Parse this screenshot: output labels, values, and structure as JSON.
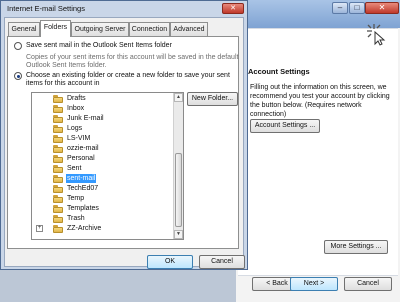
{
  "background_window": {
    "heading": "Account Settings",
    "description": "Filling out the information on this screen, we recommend you test your account by clicking the button below. (Requires network connection)",
    "test_button_label": "Account Settings ...",
    "more_settings_label": "More Settings ...",
    "back_label": "< Back",
    "next_label": "Next >",
    "cancel_label": "Cancel"
  },
  "dialog": {
    "title": "Internet E-mail Settings",
    "close_symbol": "✕",
    "tabs": [
      {
        "label": "General"
      },
      {
        "label": "Folders"
      },
      {
        "label": "Outgoing Server"
      },
      {
        "label": "Connection"
      },
      {
        "label": "Advanced"
      }
    ],
    "active_tab": "Folders",
    "option_default_label": "Save sent mail in the Outlook Sent Items folder",
    "option_default_desc_line1": "Copies of your sent items for this account will be saved in the default",
    "option_default_desc_line2": "Outlook Sent Items folder.",
    "option_choose_line1": "Choose an existing folder or create a new folder to save your sent",
    "option_choose_line2": "items for this account in",
    "new_folder_label": "New Folder...",
    "folders": [
      {
        "name": "Drafts"
      },
      {
        "name": "Inbox"
      },
      {
        "name": "Junk E-mail"
      },
      {
        "name": "Logs"
      },
      {
        "name": "LS-VIM"
      },
      {
        "name": "ozzie-mail"
      },
      {
        "name": "Personal"
      },
      {
        "name": "Sent"
      },
      {
        "name": "sent-mail"
      },
      {
        "name": "TechEd07"
      },
      {
        "name": "Temp"
      },
      {
        "name": "Templates"
      },
      {
        "name": "Trash"
      },
      {
        "name": "ZZ-Archive"
      }
    ],
    "selected_folder": "sent-mail",
    "ok_label": "OK",
    "cancel_label": "Cancel"
  },
  "colors": {
    "selection": "#3399ff",
    "folder": "#f2c85b",
    "dialog_frame": "#c9d6e8"
  }
}
